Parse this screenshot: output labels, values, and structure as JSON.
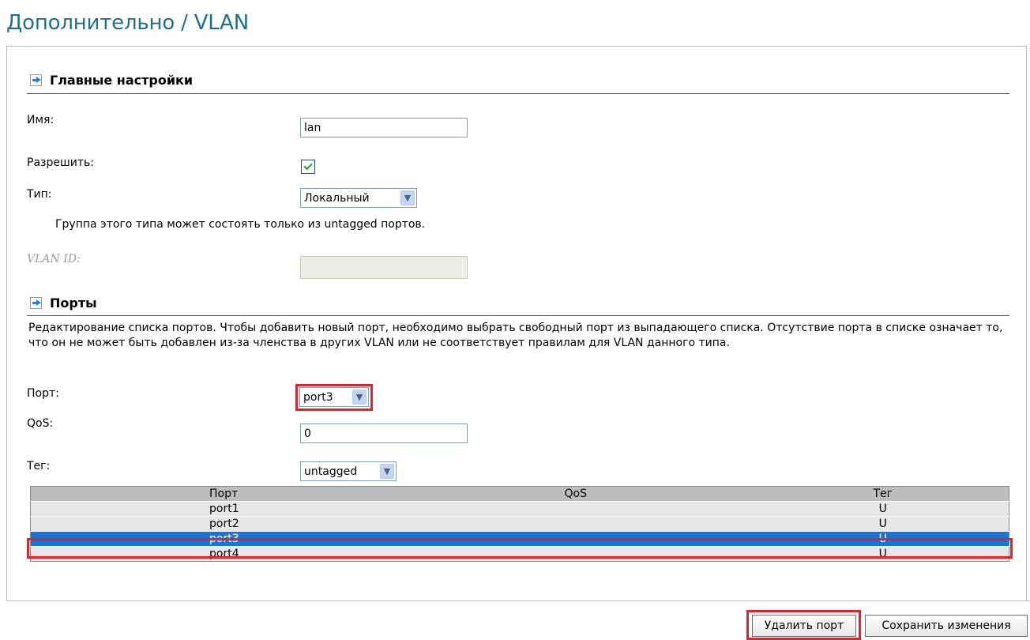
{
  "page": {
    "title": "Дополнительно / VLAN"
  },
  "main_settings": {
    "heading": "Главные настройки",
    "name_label": "Имя:",
    "name_value": "lan",
    "enable_label": "Разрешить:",
    "enable_checked": true,
    "type_label": "Тип:",
    "type_value": "Локальный",
    "type_note": "Группа этого типа может состоять только из untagged портов.",
    "vlan_id_label": "VLAN ID:",
    "vlan_id_value": ""
  },
  "ports": {
    "heading": "Порты",
    "description": "Редактирование списка портов. Чтобы добавить новый порт, необходимо выбрать свободный порт из выпадающего списка. Отсутствие порта в списке означает то, что он не может быть добавлен из-за членства в других VLAN или не соответствует правилам для VLAN данного типа.",
    "port_label": "Порт:",
    "port_value": "port3",
    "qos_label": "QoS:",
    "qos_value": "0",
    "tag_label": "Тег:",
    "tag_value": "untagged",
    "table": {
      "headers": [
        "Порт",
        "QoS",
        "Тег"
      ],
      "rows": [
        {
          "port": "port1",
          "qos": "",
          "tag": "U"
        },
        {
          "port": "port2",
          "qos": "",
          "tag": "U"
        },
        {
          "port": "port3",
          "qos": "",
          "tag": "U"
        },
        {
          "port": "port4",
          "qos": "",
          "tag": "U"
        }
      ],
      "selected_index": 2
    }
  },
  "buttons": {
    "delete_port": "Удалить порт",
    "save_changes": "Сохранить изменения"
  },
  "colors": {
    "title": "#1f6f8b",
    "highlight": "#e8202a",
    "row_selected": "#1476d6"
  },
  "icons": {
    "section": "arrow-right-icon",
    "dropdown": "chevron-down-icon",
    "checkbox": "check-icon"
  }
}
